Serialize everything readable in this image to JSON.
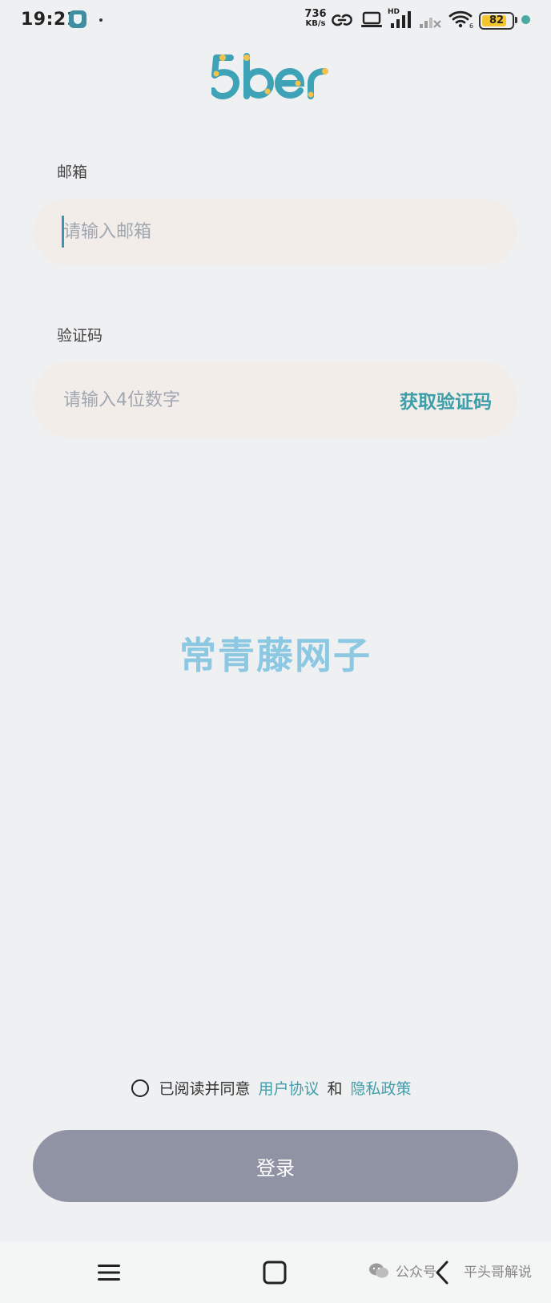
{
  "status_bar": {
    "time": "19:21",
    "net_speed_value": "736",
    "net_speed_unit": "KB/s",
    "hd_label": "HD",
    "battery_level": "82",
    "battery_fraction": 0.82
  },
  "colors": {
    "accent": "#3b9ea8",
    "background": "#eff0f2",
    "field_background": "#f3ede9",
    "login_button": "#8f93a3",
    "watermark": "#8cc8e2"
  },
  "form": {
    "email_label": "邮箱",
    "email_placeholder": "请输入邮箱",
    "code_label": "验证码",
    "code_placeholder": "请输入4位数字",
    "get_code_label": "获取验证码"
  },
  "watermark_text": "常青藤网子",
  "agreement": {
    "prefix": "已阅读并同意",
    "user_agreement": "用户协议",
    "conjunction": "和",
    "privacy_policy": "隐私政策"
  },
  "login_label": "登录",
  "footer": {
    "wechat_label": "公众号",
    "account_name": "平头哥解说"
  }
}
